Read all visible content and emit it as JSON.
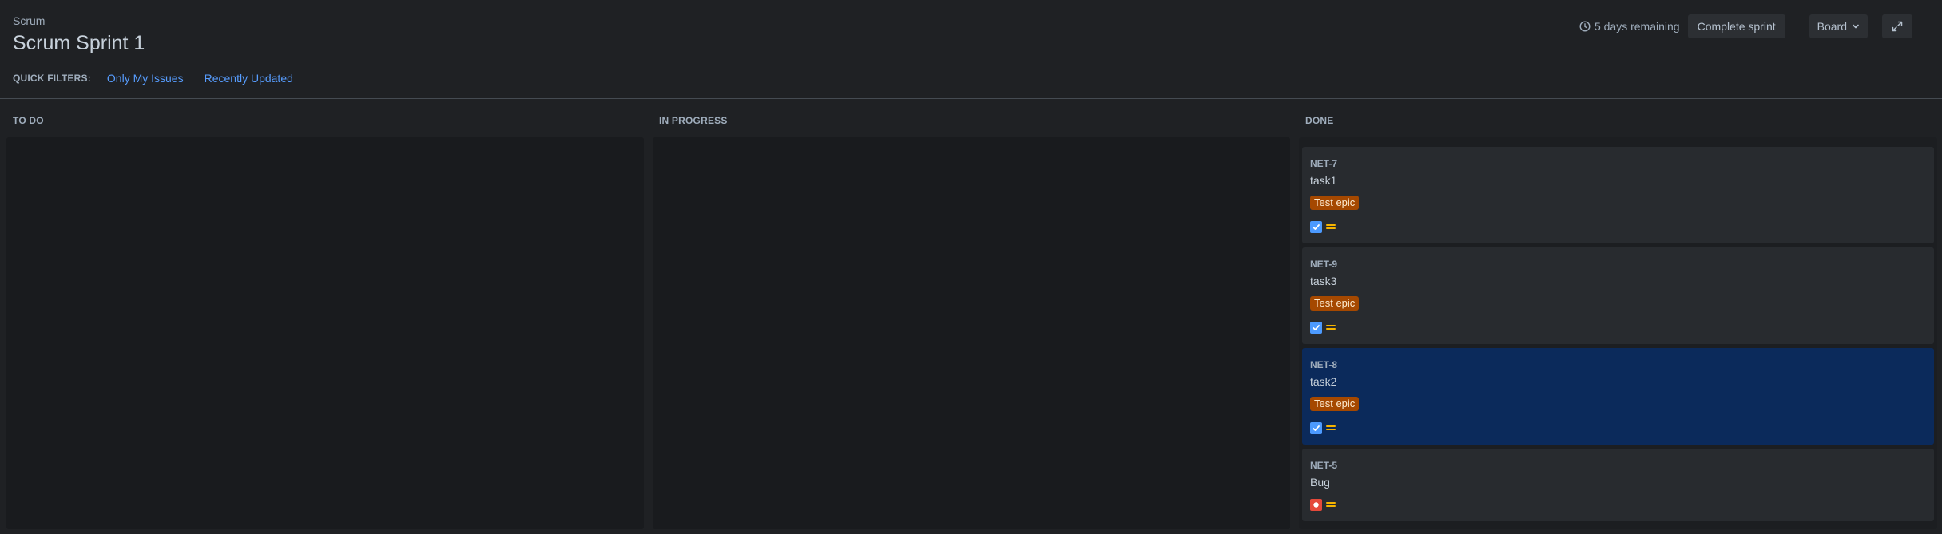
{
  "header": {
    "breadcrumb": "Scrum",
    "title": "Scrum Sprint 1",
    "remaining": "5 days remaining",
    "complete_label": "Complete sprint",
    "board_label": "Board"
  },
  "quick_filters": {
    "label": "QUICK FILTERS:",
    "items": [
      "Only My Issues",
      "Recently Updated"
    ]
  },
  "columns": {
    "todo": "TO DO",
    "in_progress": "IN PROGRESS",
    "done": "DONE"
  },
  "cards": [
    {
      "key": "NET-7",
      "summary": "task1",
      "epic": "Test epic",
      "type": "task",
      "priority": "medium"
    },
    {
      "key": "NET-9",
      "summary": "task3",
      "epic": "Test epic",
      "type": "task",
      "priority": "medium"
    },
    {
      "key": "NET-8",
      "summary": "task2",
      "epic": "Test epic",
      "type": "task",
      "priority": "medium",
      "selected": true
    },
    {
      "key": "NET-5",
      "summary": "Bug",
      "type": "bug",
      "priority": "medium"
    }
  ],
  "colors": {
    "background": "#1f2124",
    "link": "#579dff",
    "epic": "#a54800",
    "selected_card": "#0b2a5b",
    "task_icon": "#4c9aff",
    "bug_icon": "#e5493a",
    "priority_medium": "#f5b400"
  },
  "icons": {
    "clock": "clock-icon",
    "board_dropdown": "chevron-down-icon",
    "expand": "expand-icon",
    "task": "task-checkbox-icon",
    "bug": "bug-icon",
    "priority": "priority-medium-icon"
  }
}
